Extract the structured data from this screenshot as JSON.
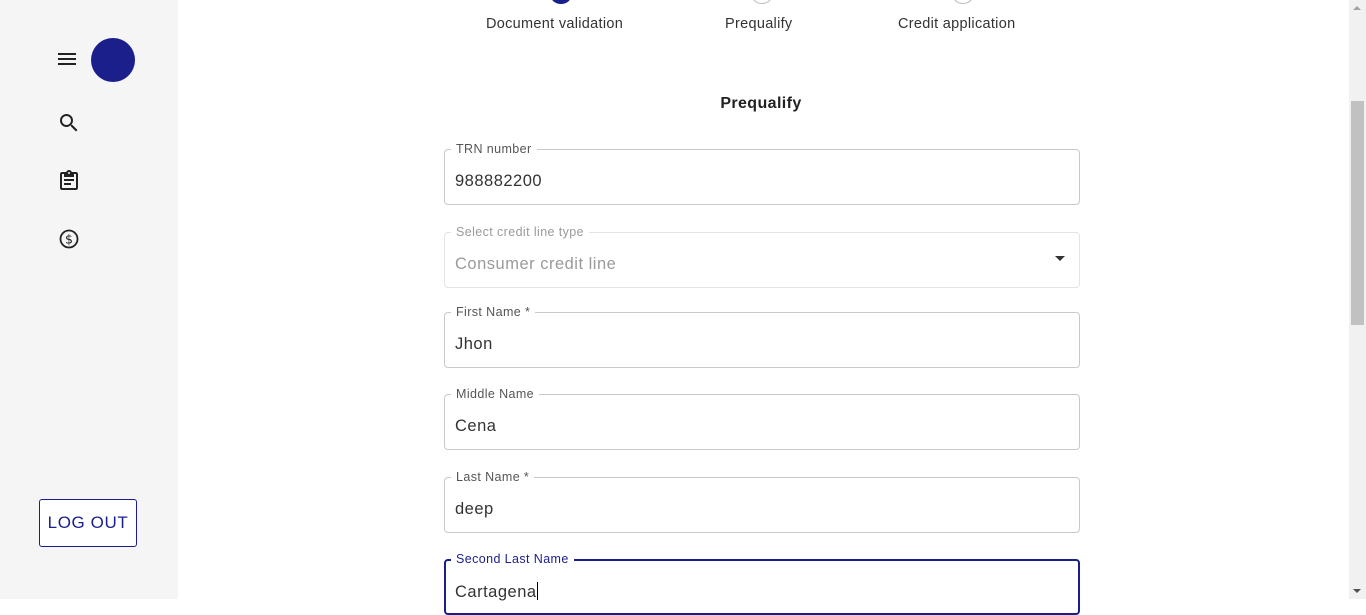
{
  "sidebar": {
    "logout_label": "LOG OUT",
    "icons": [
      "menu-icon",
      "search-icon",
      "clipboard-icon",
      "dollar-icon"
    ]
  },
  "stepper": {
    "steps": [
      {
        "label": "Document validation",
        "state": "completed"
      },
      {
        "label": "Prequalify",
        "state": "active"
      },
      {
        "label": "Credit application",
        "state": "pending"
      }
    ]
  },
  "form": {
    "title": "Prequalify",
    "fields": [
      {
        "label": "TRN number",
        "value": "988882200"
      },
      {
        "label": "Select credit line type",
        "value": "Consumer credit line"
      },
      {
        "label": "First Name *",
        "value": "Jhon"
      },
      {
        "label": "Middle Name",
        "value": "Cena"
      },
      {
        "label": "Last Name *",
        "value": "deep"
      },
      {
        "label": "Second Last Name",
        "value": "Cartagena"
      }
    ]
  },
  "colors": {
    "primary": "#1a1f8c",
    "sidebar_bg": "#f5f5f5",
    "border": "#c9c9c9"
  }
}
